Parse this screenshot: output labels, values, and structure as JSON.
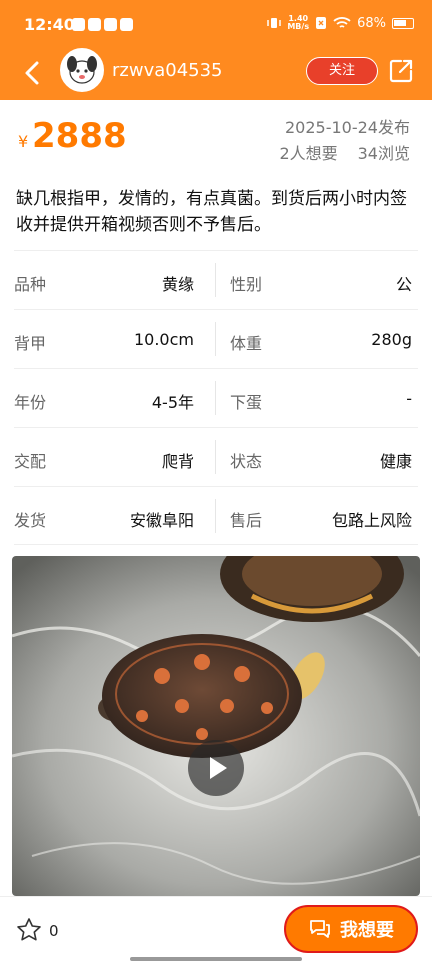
{
  "status_bar": {
    "time": "12:40",
    "net_speed_value": "1.40",
    "net_speed_unit": "MB/s",
    "battery": "68%"
  },
  "navbar": {
    "username": "rzwva04535",
    "follow_label": "关注"
  },
  "listing": {
    "currency": "¥",
    "price": "2888",
    "published": "2025-10-24发布",
    "wants": "2人想要",
    "views": "34浏览",
    "description": "缺几根指甲，发情的，有点真菌。到货后两小时内签收并提供开箱视频否则不予售后。"
  },
  "specs": [
    {
      "left_label": "品种",
      "left_value": "黄缘",
      "right_label": "性别",
      "right_value": "公"
    },
    {
      "left_label": "背甲",
      "left_value": "10.0cm",
      "right_label": "体重",
      "right_value": "280g"
    },
    {
      "left_label": "年份",
      "left_value": "4-5年",
      "right_label": "下蛋",
      "right_value": "-"
    },
    {
      "left_label": "交配",
      "left_value": "爬背",
      "right_label": "状态",
      "right_value": "健康"
    },
    {
      "left_label": "发货",
      "left_value": "安徽阜阳",
      "right_label": "售后",
      "right_value": "包路上风险"
    }
  ],
  "bottom_bar": {
    "favorite_count": "0",
    "want_label": "我想要"
  },
  "colors": {
    "brand_orange": "#ff8a1f",
    "price_orange": "#ff7a00",
    "follow_red": "#e8402a"
  }
}
